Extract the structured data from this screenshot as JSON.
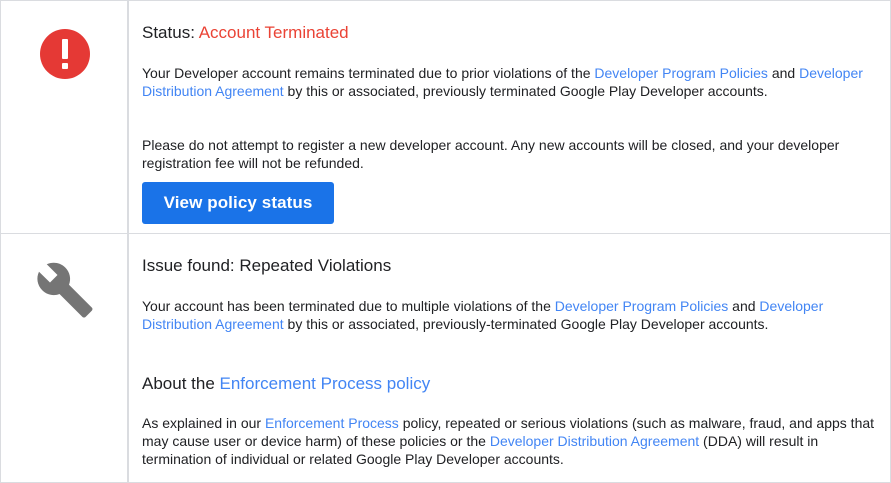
{
  "status_section": {
    "icon": "exclamation-circle-icon",
    "status_prefix": "Status: ",
    "status_value": "Account Terminated",
    "p1": {
      "t1": "Your Developer account remains terminated due to prior violations of the ",
      "link1": "Developer Program Policies",
      "t2": " and ",
      "link2": "Developer Distribution Agreement",
      "t3": " by this or associated, previously terminated Google Play Developer accounts."
    },
    "p2": "Please do not attempt to register a new developer account. Any new accounts will be closed, and your developer registration fee will not be refunded.",
    "button_label": "View policy status"
  },
  "issue_section": {
    "icon": "wrench-icon",
    "heading": "Issue found: Repeated Violations",
    "p1": {
      "t1": "Your account has been terminated due to multiple violations of the ",
      "link1": "Developer Program Policies",
      "t2": " and ",
      "link2": "Developer Distribution Agreement",
      "t3": " by this or associated, previously-terminated Google Play Developer accounts."
    },
    "about_prefix": "About the ",
    "about_link": "Enforcement Process policy",
    "p2": {
      "t1": "As explained in our ",
      "link1": "Enforcement Process",
      "t2": " policy, repeated or serious violations (such as malware, fraud, and apps that may cause user or device harm) of these policies or the ",
      "link2": "Developer Distribution Agreement",
      "t3": " (DDA) will result in termination of individual or related Google Play Developer accounts."
    }
  },
  "colors": {
    "alert_red": "#ea4335",
    "link_blue": "#4285f4",
    "button_blue": "#1a73e8",
    "icon_gray": "#757575"
  }
}
